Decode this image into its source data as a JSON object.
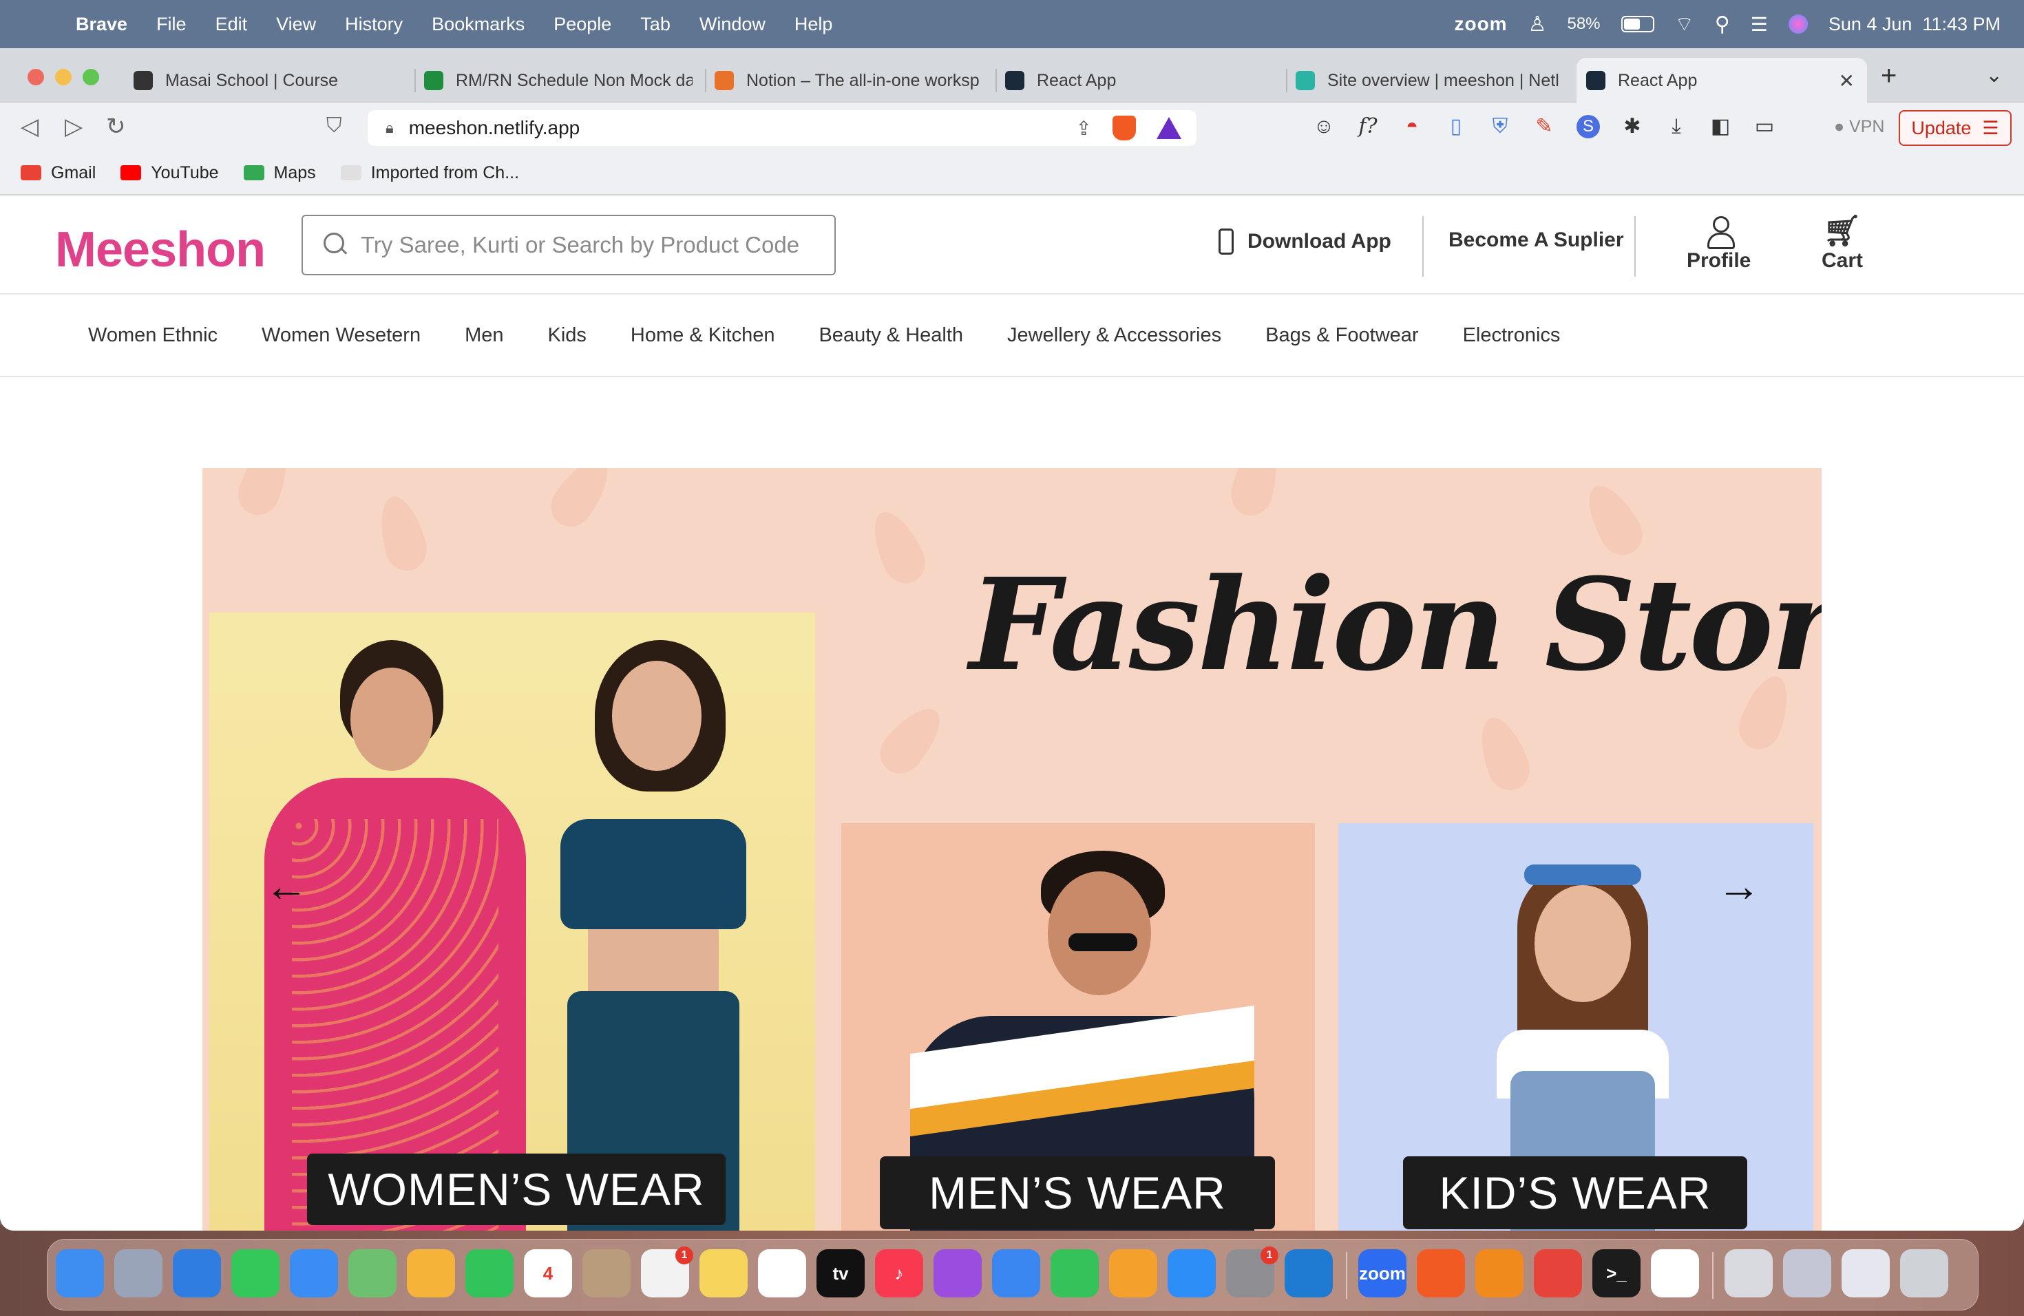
{
  "menubar": {
    "app": "Brave",
    "items": [
      "File",
      "Edit",
      "View",
      "History",
      "Bookmarks",
      "People",
      "Tab",
      "Window",
      "Help"
    ],
    "zoom": "zoom",
    "battery_pct": "58%",
    "battery_level": 0.58,
    "datetime": "Sun 4 Jun  11:43 PM"
  },
  "browser": {
    "tabs": [
      {
        "title": "Masai School | Course",
        "icon": "globe-icon",
        "color": "#333333"
      },
      {
        "title": "RM/RN Schedule Non Mock da",
        "icon": "sheets-icon",
        "color": "#1e8e3e"
      },
      {
        "title": "Notion – The all-in-one worksp",
        "icon": "notion-icon",
        "color": "#e8722a"
      },
      {
        "title": "React App",
        "icon": "react-icon",
        "color": "#1b2a3a"
      },
      {
        "title": "Site overview | meeshon | Netl",
        "icon": "netlify-icon",
        "color": "#2bb3a3"
      },
      {
        "title": "React App",
        "icon": "react-icon",
        "color": "#1b2a3a",
        "active": true
      }
    ],
    "url": "meeshon.netlify.app",
    "vpn": "VPN",
    "update": "Update",
    "bookmarks": [
      {
        "label": "Gmail",
        "color": "#ea4335"
      },
      {
        "label": "YouTube",
        "color": "#ff0000"
      },
      {
        "label": "Maps",
        "color": "#34a853"
      },
      {
        "label": "Imported from Ch...",
        "color": "#e0e0e0"
      }
    ]
  },
  "site": {
    "logo": "Meeshon",
    "search_placeholder": "Try Saree, Kurti or Search by Product Code",
    "download_app": "Download App",
    "become_supplier": "Become A Suplier",
    "profile": "Profile",
    "cart": "Cart",
    "categories": [
      "Women Ethnic",
      "Women Wesetern",
      "Men",
      "Kids",
      "Home & Kitchen",
      "Beauty & Health",
      "Jewellery & Accessories",
      "Bags & Footwear",
      "Electronics"
    ],
    "banner": {
      "title": "Fashion Store",
      "women": "WOMEN’S WEAR",
      "men": "MEN’S WEAR",
      "kids": "KID’S WEAR",
      "prev": "←",
      "next": "→"
    },
    "colors": {
      "brand": "#e0428a",
      "banner_bg": "#f8d6c6"
    }
  },
  "dock": {
    "apps": [
      {
        "name": "finder",
        "label": "",
        "color": "#3d8ef0"
      },
      {
        "name": "launchpad",
        "label": "",
        "color": "#9aa4b8"
      },
      {
        "name": "safari",
        "label": "",
        "color": "#2f7de1"
      },
      {
        "name": "messages",
        "label": "",
        "color": "#34c759"
      },
      {
        "name": "mail",
        "label": "",
        "color": "#3a8df5"
      },
      {
        "name": "maps",
        "label": "",
        "color": "#6cc070"
      },
      {
        "name": "photos",
        "label": "",
        "color": "#f5b33a"
      },
      {
        "name": "facetime",
        "label": "",
        "color": "#32c45a"
      },
      {
        "name": "calendar",
        "label": "4",
        "color": "#ffffff"
      },
      {
        "name": "contacts",
        "label": "",
        "color": "#b89c7c"
      },
      {
        "name": "reminders",
        "label": "",
        "color": "#f2f2f2",
        "badge": "1"
      },
      {
        "name": "notes",
        "label": "",
        "color": "#f7d45b"
      },
      {
        "name": "freeform",
        "label": "",
        "color": "#ffffff"
      },
      {
        "name": "tv",
        "label": "tv",
        "color": "#111111"
      },
      {
        "name": "music",
        "label": "♪",
        "color": "#f8394f"
      },
      {
        "name": "podcasts",
        "label": "",
        "color": "#9b4de0"
      },
      {
        "name": "keynote",
        "label": "",
        "color": "#3a87f2"
      },
      {
        "name": "numbers",
        "label": "",
        "color": "#35c25a"
      },
      {
        "name": "pages",
        "label": "",
        "color": "#f4a02c"
      },
      {
        "name": "app-store",
        "label": "",
        "color": "#2c8ef6"
      },
      {
        "name": "system-settings",
        "label": "",
        "color": "#8e8e93",
        "badge": "1"
      },
      {
        "name": "vscode",
        "label": "",
        "color": "#1f7ad1"
      },
      {
        "name": "zoom",
        "label": "zoom",
        "color": "#2d6bf0"
      },
      {
        "name": "brave",
        "label": "",
        "color": "#f25a24"
      },
      {
        "name": "vlc",
        "label": "",
        "color": "#f08a1c"
      },
      {
        "name": "chrome",
        "label": "",
        "color": "#e6443a"
      },
      {
        "name": "terminal",
        "label": ">_",
        "color": "#1c1c1c"
      },
      {
        "name": "slack",
        "label": "",
        "color": "#ffffff"
      },
      {
        "name": "downloads",
        "label": "",
        "color": "#d9d9e0"
      },
      {
        "name": "recent-1",
        "label": "",
        "color": "#c4c6d6"
      },
      {
        "name": "recent-2",
        "label": "",
        "color": "#e6e6ee"
      },
      {
        "name": "trash",
        "label": "",
        "color": "#cfd3d8"
      }
    ]
  }
}
